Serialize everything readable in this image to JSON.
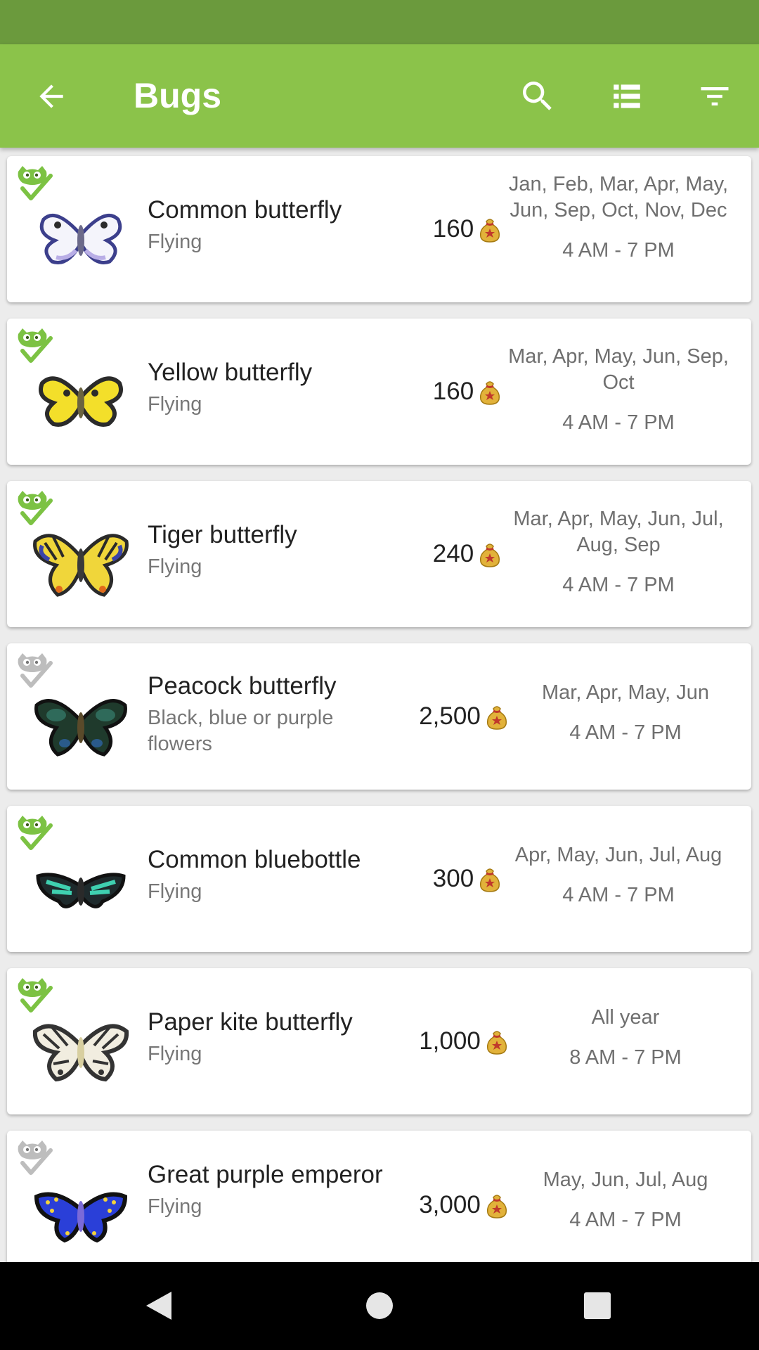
{
  "app": {
    "title": "Bugs",
    "accent_color": "#8bc34a",
    "status_bar_color": "#6b9a3d",
    "back_icon": "arrow-back-icon",
    "search_icon": "search-icon",
    "view_icon": "list-view-icon",
    "filter_icon": "filter-icon"
  },
  "bugs": [
    {
      "name": "Common butterfly",
      "location": "Flying",
      "price": "160",
      "months": "Jan, Feb, Mar, Apr, May, Jun, Sep, Oct, Nov, Dec",
      "hours": "4 AM - 7 PM",
      "caught": true
    },
    {
      "name": "Yellow butterfly",
      "location": "Flying",
      "price": "160",
      "months": "Mar, Apr, May, Jun, Sep, Oct",
      "hours": "4 AM - 7 PM",
      "caught": true
    },
    {
      "name": "Tiger butterfly",
      "location": "Flying",
      "price": "240",
      "months": "Mar, Apr, May, Jun, Jul, Aug, Sep",
      "hours": "4 AM - 7 PM",
      "caught": true
    },
    {
      "name": "Peacock butterfly",
      "location": "Black, blue or purple flowers",
      "price": "2,500",
      "months": "Mar, Apr, May, Jun",
      "hours": "4 AM - 7 PM",
      "caught": false
    },
    {
      "name": "Common bluebottle",
      "location": "Flying",
      "price": "300",
      "months": "Apr, May, Jun, Jul, Aug",
      "hours": "4 AM - 7 PM",
      "caught": true
    },
    {
      "name": "Paper kite butterfly",
      "location": "Flying",
      "price": "1,000",
      "months": "All year",
      "hours": "8 AM - 7 PM",
      "caught": true
    },
    {
      "name": "Great purple emperor",
      "location": "Flying",
      "price": "3,000",
      "months": "May, Jun, Jul, Aug",
      "hours": "4 AM - 7 PM",
      "caught": false
    }
  ],
  "navigation": {
    "back": "nav-back-icon",
    "home": "nav-home-icon",
    "recents": "nav-recents-icon"
  }
}
